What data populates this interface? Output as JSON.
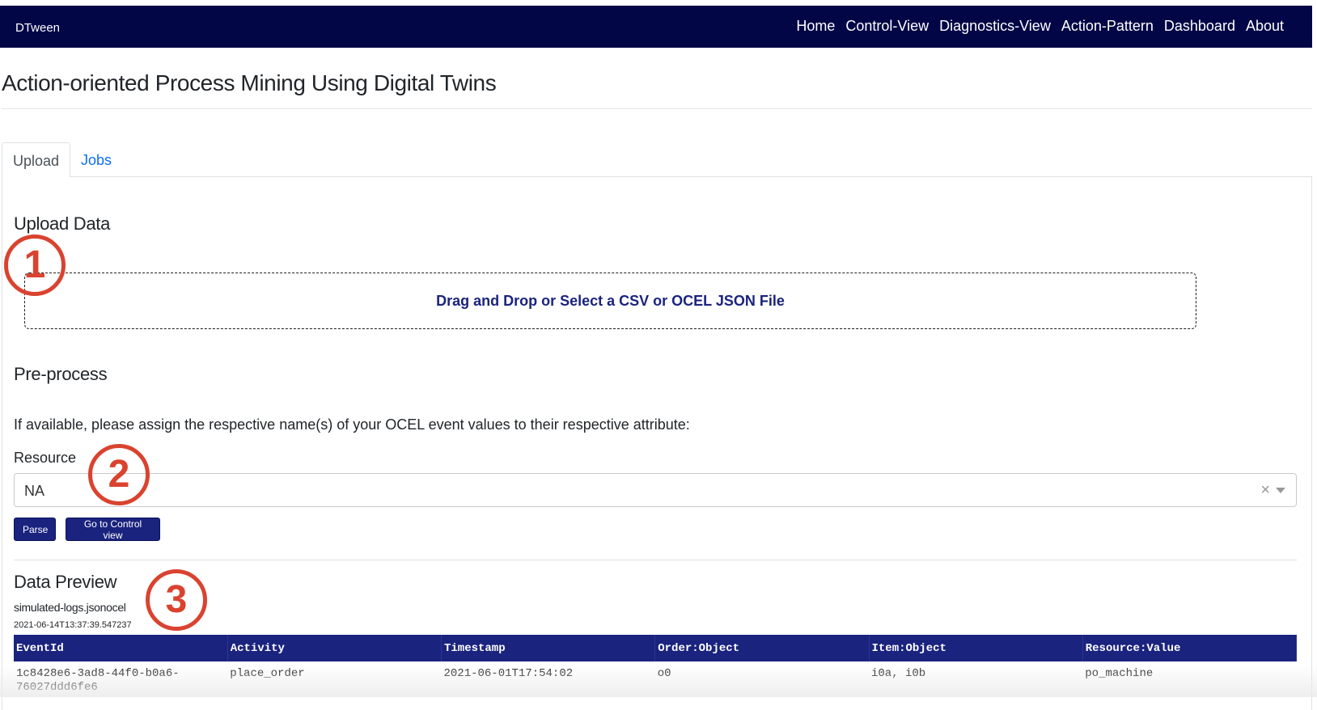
{
  "navbar": {
    "brand": "DTween",
    "links": [
      "Home",
      "Control-View",
      "Diagnostics-View",
      "Action-Pattern",
      "Dashboard",
      "About"
    ]
  },
  "page_title": "Action-oriented Process Mining Using Digital Twins",
  "tabs": [
    {
      "label": "Upload",
      "active": true
    },
    {
      "label": "Jobs",
      "active": false
    }
  ],
  "upload": {
    "heading": "Upload Data",
    "dropzone_text": "Drag and Drop or Select a CSV or OCEL JSON File"
  },
  "preprocess": {
    "heading": "Pre-process",
    "instructions": "If available, please assign the respective name(s) of your OCEL event values to their respective attribute:",
    "resource_label": "Resource",
    "resource_value": "NA",
    "clear_symbol": "×",
    "parse_button": "Parse",
    "control_button": "Go to Control view"
  },
  "annotations": [
    "1",
    "2",
    "3"
  ],
  "preview": {
    "heading": "Data Preview",
    "filename": "simulated-logs.jsonocel",
    "timestamp": "2021-06-14T13:37:39.547237",
    "columns": [
      "EventId",
      "Activity",
      "Timestamp",
      "Order:Object",
      "Item:Object",
      "Resource:Value"
    ],
    "rows": [
      [
        "1c8428e6-3ad8-44f0-b0a6-76027ddd6fe6",
        "place_order",
        "2021-06-01T17:54:02",
        "o0",
        "i0a, i0b",
        "po_machine"
      ]
    ]
  },
  "colors": {
    "navbar_bg": "#020546",
    "accent": "#1a237e",
    "annotation": "#d9432f",
    "tab_link": "#0d6efd"
  }
}
